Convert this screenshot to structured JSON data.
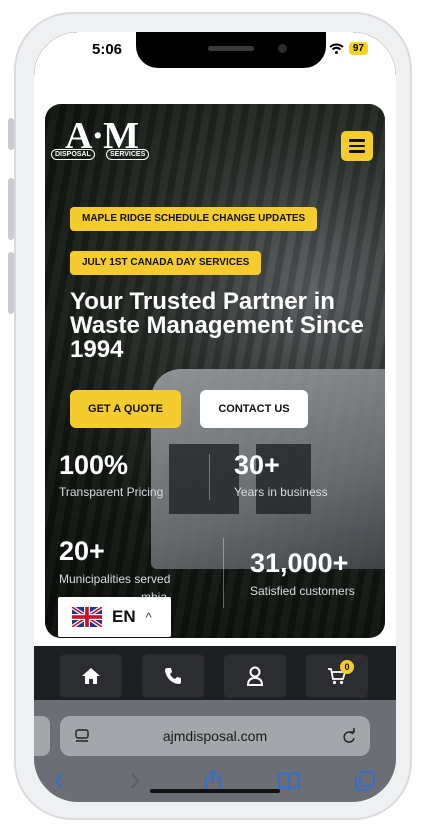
{
  "status": {
    "time": "5:06",
    "battery": "97"
  },
  "logo": {
    "text": "A·M",
    "tag_left": "DISPOSAL",
    "tag_right": "SERVICES"
  },
  "hero": {
    "announcement_1": "MAPLE RIDGE SCHEDULE CHANGE UPDATES",
    "announcement_2": "JULY 1ST CANADA DAY SERVICES",
    "headline": "Your Trusted Partner in Waste Management Since 1994",
    "quote_button": "GET A QUOTE",
    "contact_button": "CONTACT US",
    "stats": [
      {
        "value": "100%",
        "label": "Transparent Pricing"
      },
      {
        "value": "30+",
        "label": "Years in business"
      },
      {
        "value": "20+",
        "label": "Municipalities served"
      },
      {
        "value": "31,000+",
        "label": "Satisfied customers"
      }
    ],
    "partial_label": "mbia"
  },
  "language": {
    "code": "EN",
    "caret": "^"
  },
  "bottom_nav": {
    "cart_count": "0"
  },
  "browser": {
    "url": "ajmdisposal.com"
  },
  "colors": {
    "accent": "#f4cc2e",
    "dark_bar": "#1e1f22",
    "safari_bar": "#6b6e74",
    "link_blue": "#2f6fd6"
  },
  "icons": [
    "home-icon",
    "phone-icon",
    "user-icon",
    "cart-icon",
    "menu-icon",
    "uk-flag-icon",
    "reader-icon",
    "reload-icon",
    "back-icon",
    "forward-icon",
    "share-icon",
    "bookmarks-icon",
    "tabs-icon"
  ]
}
